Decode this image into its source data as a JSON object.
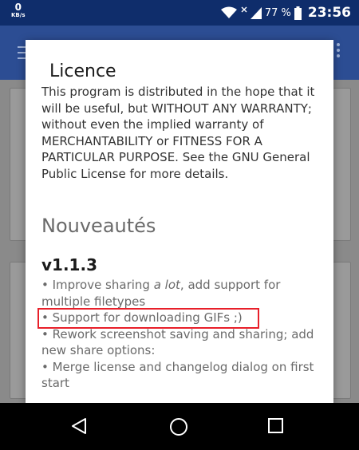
{
  "status_bar": {
    "net_speed_value": "0",
    "net_speed_unit": "KB/s",
    "battery_percent": "77 %",
    "time": "23:56",
    "icons": [
      "wifi-icon",
      "no-data-icon",
      "signal-icon",
      "battery-icon"
    ]
  },
  "dialog": {
    "title": "Licence",
    "licence_text": "This program is distributed in the hope that it will be useful, but WITHOUT ANY WARRANTY; without even the implied warranty of MERCHANTABILITY or FITNESS FOR A PARTICULAR PURPOSE. See the GNU General Public License for more details.",
    "changelog_title": "Nouveautés",
    "version": "v1.1.3",
    "changes": [
      {
        "prefix": "• Improve sharing ",
        "emphasis": "a lot",
        "suffix": ", add support for multiple filetypes"
      },
      {
        "text": "• Support for downloading GIFs ;)"
      },
      {
        "text": "• Rework screenshot saving and sharing; add new share options:"
      },
      {
        "text": "• Merge license and changelog dialog on first start"
      }
    ]
  },
  "nav_bar": {
    "buttons": [
      "back-icon",
      "home-icon",
      "recents-icon"
    ]
  },
  "colors": {
    "status_bar": "#0f2d6b",
    "toolbar": "#2c4d93",
    "scrim": "#8a8a8a",
    "highlight": "#e8202a"
  }
}
